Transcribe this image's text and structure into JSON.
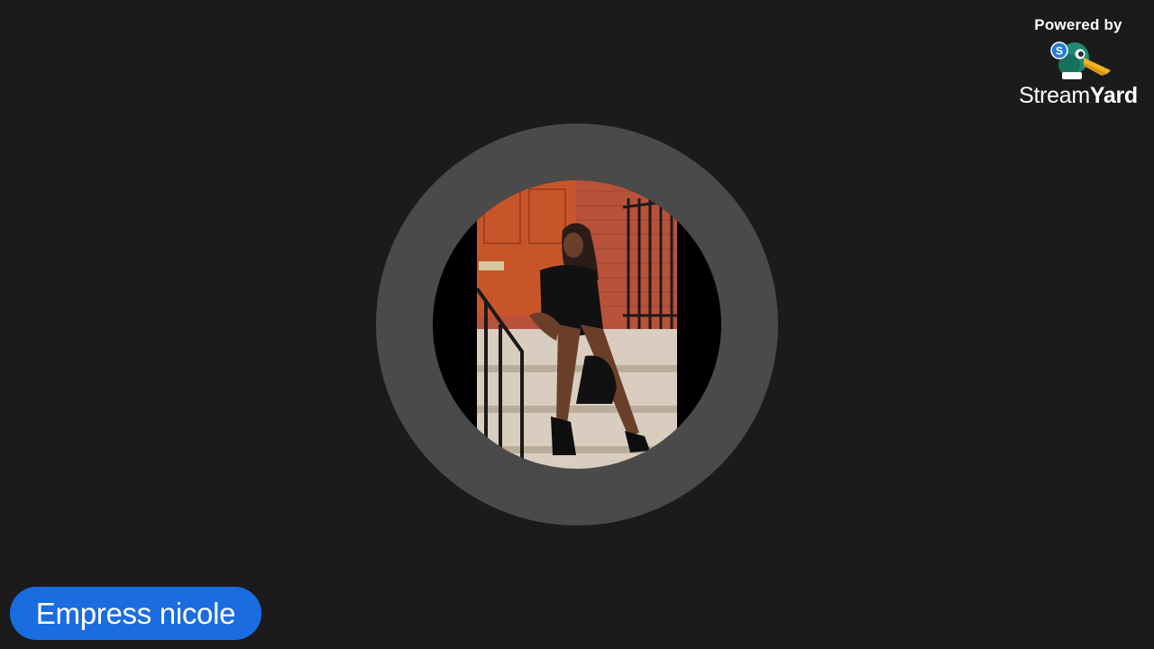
{
  "branding": {
    "powered_by": "Powered by",
    "brand_light": "Stream",
    "brand_bold": "Yard",
    "logo_icon": "streamyard-duck-logo-icon",
    "badge_letter": "S"
  },
  "participant": {
    "name": "Empress nicole",
    "avatar_image": "participant-photo"
  },
  "colors": {
    "background": "#1b1b1b",
    "ring": "#4a4a4a",
    "name_tag": "#1a6de0",
    "text": "#ffffff"
  }
}
